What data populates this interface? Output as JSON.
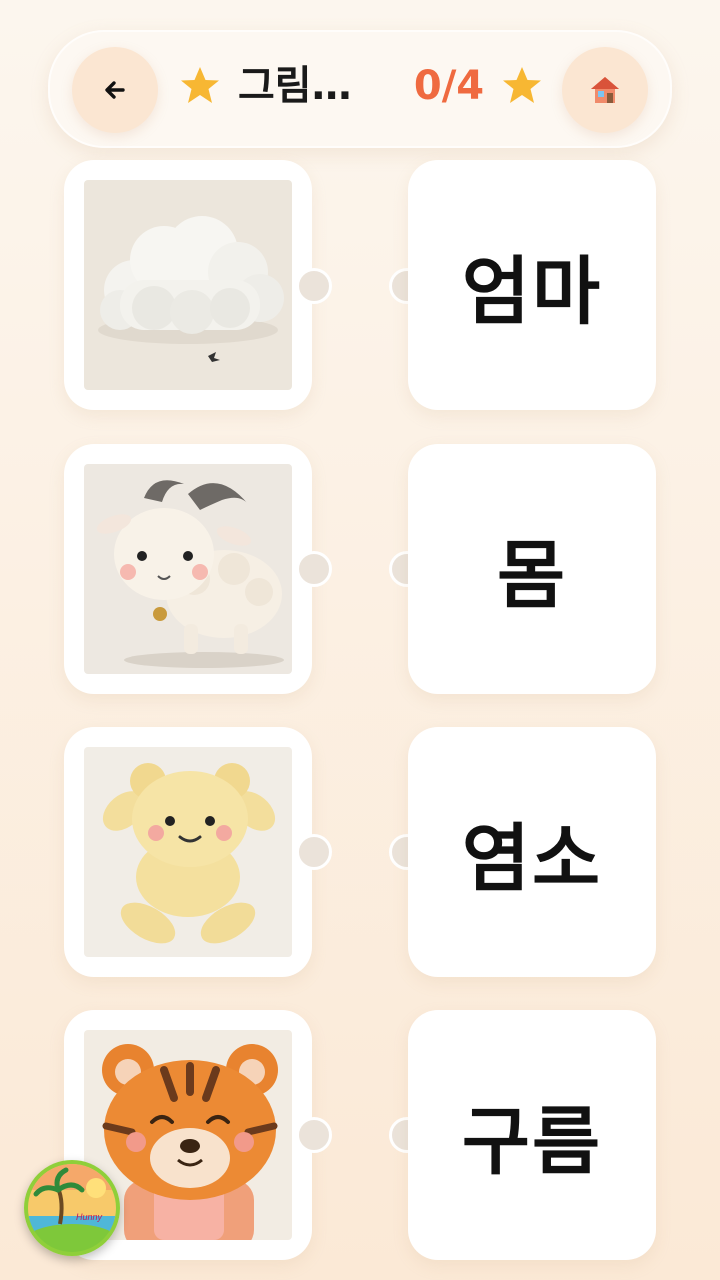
{
  "header": {
    "title": "그림…",
    "score": "0/4",
    "back_icon": "back-arrow-icon",
    "home_icon": "house-icon",
    "star_icon": "star-icon",
    "accent_color": "#ef6a40",
    "star_color": "#f7b733"
  },
  "pictures": [
    {
      "subject": "cloud",
      "icon": "cloud-image"
    },
    {
      "subject": "goat",
      "icon": "goat-image"
    },
    {
      "subject": "bear",
      "icon": "bear-image"
    },
    {
      "subject": "tiger",
      "icon": "tiger-image"
    }
  ],
  "words": [
    {
      "label": "엄마"
    },
    {
      "label": "몸"
    },
    {
      "label": "염소"
    },
    {
      "label": "구름"
    }
  ],
  "badge": {
    "icon": "beach-island-badge-icon",
    "text": "Hunny"
  }
}
